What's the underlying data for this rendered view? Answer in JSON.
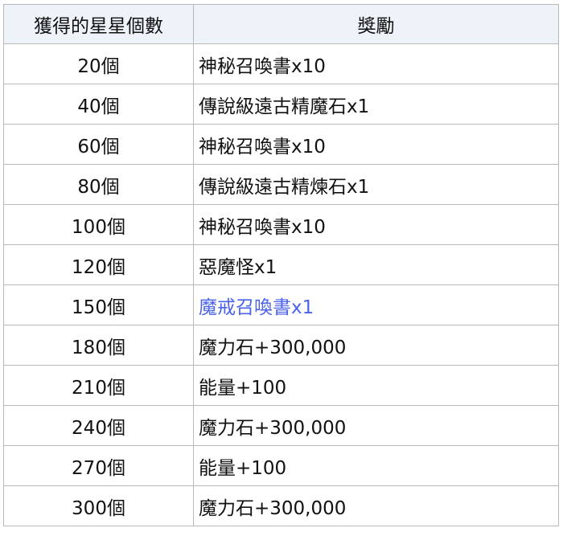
{
  "table": {
    "headers": {
      "count": "獲得的星星個數",
      "reward": "獎勵"
    },
    "rows": [
      {
        "count": "20個",
        "reward": "神秘召喚書x10",
        "link": false
      },
      {
        "count": "40個",
        "reward": "傳說級遠古精魔石x1",
        "link": false
      },
      {
        "count": "60個",
        "reward": "神秘召喚書x10",
        "link": false
      },
      {
        "count": "80個",
        "reward": "傳說級遠古精煉石x1",
        "link": false
      },
      {
        "count": "100個",
        "reward": "神秘召喚書x10",
        "link": false
      },
      {
        "count": "120個",
        "reward": "惡魔怪x1",
        "link": false
      },
      {
        "count": "150個",
        "reward": "魔戒召喚書x1",
        "link": true
      },
      {
        "count": "180個",
        "reward": "魔力石+300,000",
        "link": false
      },
      {
        "count": "210個",
        "reward": "能量+100",
        "link": false
      },
      {
        "count": "240個",
        "reward": "魔力石+300,000",
        "link": false
      },
      {
        "count": "270個",
        "reward": "能量+100",
        "link": false
      },
      {
        "count": "300個",
        "reward": "魔力石+300,000",
        "link": false
      }
    ]
  },
  "colors": {
    "header_bg": "#edf3f8",
    "border": "#b8b8b8",
    "link_text": "#4a63e8",
    "text": "#111111"
  }
}
